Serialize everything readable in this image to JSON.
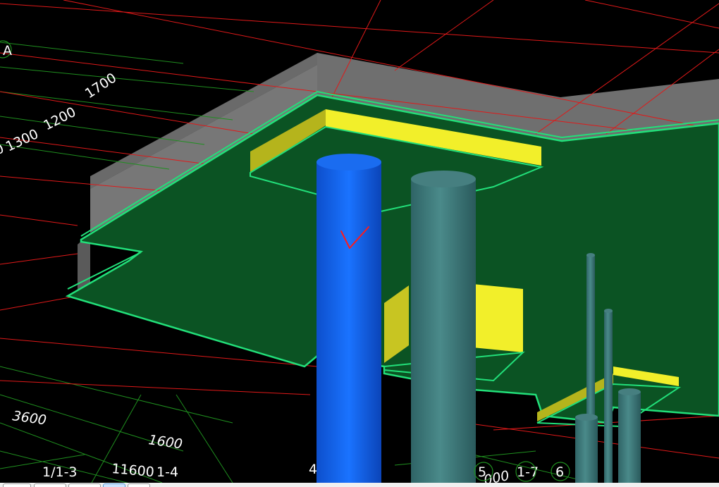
{
  "viewport": {
    "background": "#000000",
    "colors": {
      "grid_red": "#e01919",
      "grid_green": "#1f8f1f",
      "slab_fill": "#0b5323",
      "slab_edge": "#22e07a",
      "wall_gray": "#6f6f6f",
      "beam_yellow": "#f2ef2a",
      "beam_yellow_shade": "#b5b41c",
      "column_selected": "#1566e8",
      "column_teal": "#3f7a7a",
      "markup_red": "#ff1a1a"
    },
    "axis_labels": [
      {
        "text": "A",
        "role": "axis-bubble-a"
      },
      {
        "text": "1700",
        "role": "dimension"
      },
      {
        "text": "1200",
        "role": "dimension"
      },
      {
        "text": "1300",
        "role": "dimension"
      },
      {
        "text": "0",
        "role": "dimension-partial"
      },
      {
        "text": "3600",
        "role": "dimension"
      },
      {
        "text": "1600",
        "role": "dimension"
      },
      {
        "text": "1/1-3",
        "role": "axis"
      },
      {
        "text": "11600",
        "role": "dimension"
      },
      {
        "text": "1-4",
        "role": "axis"
      },
      {
        "text": "4",
        "role": "axis"
      },
      {
        "text": "5",
        "role": "axis"
      },
      {
        "text": "1-7",
        "role": "axis"
      },
      {
        "text": "6",
        "role": "axis"
      },
      {
        "text": "000",
        "role": "dimension-partial"
      }
    ],
    "markup_annotation": "check-mark-sketch"
  },
  "tabbar": {
    "tabs": [
      {
        "label": "",
        "active": false
      },
      {
        "label": "",
        "active": false
      },
      {
        "label": "",
        "active": false
      },
      {
        "label": "",
        "active": true
      },
      {
        "label": "",
        "active": false
      }
    ]
  }
}
